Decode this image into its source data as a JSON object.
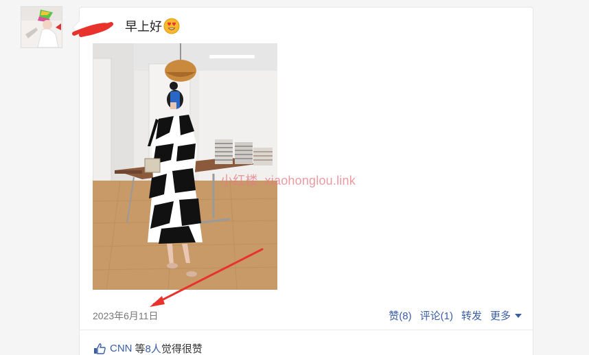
{
  "post": {
    "text": "早上好",
    "date": "2023年6月11日",
    "watermark_a": "小红楼",
    "watermark_b": "xiaohonglou.link"
  },
  "actions": {
    "like": "赞(8)",
    "comment": "评论(1)",
    "share": "转发",
    "more": "更多"
  },
  "likes": {
    "user": "CNN",
    "mid": "等",
    "count": "8人",
    "tail": "觉得很赞"
  },
  "colors": {
    "link": "#3a5ea6",
    "annotation_red": "#e8322e",
    "watermark": "#e67882"
  }
}
